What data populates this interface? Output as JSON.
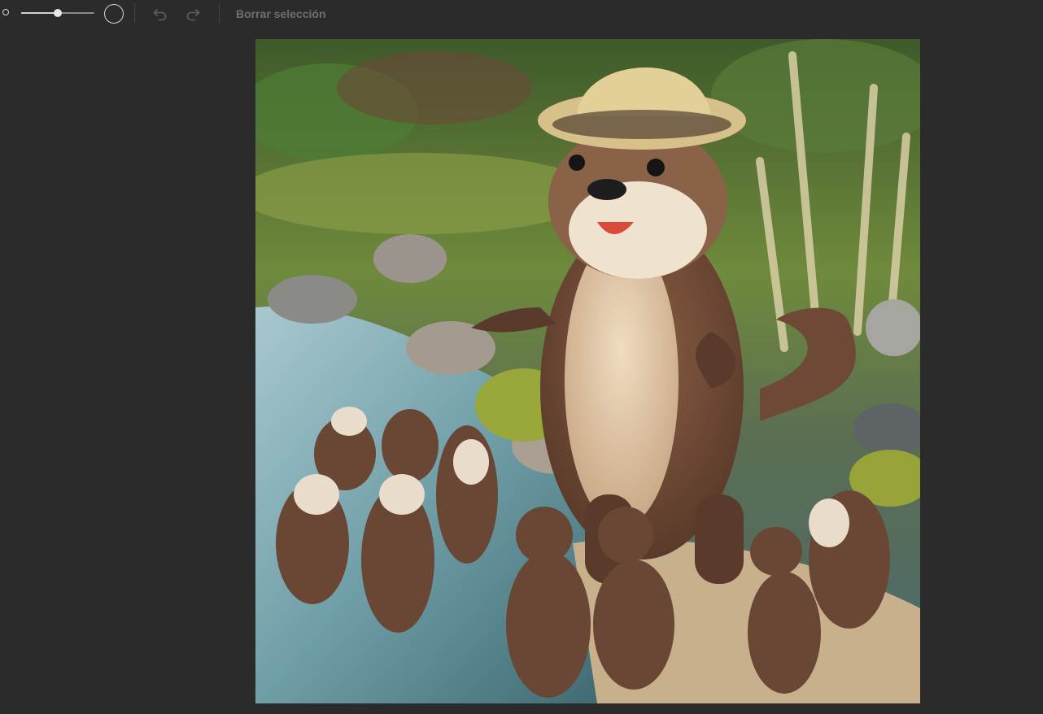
{
  "toolbar": {
    "brush_size_small_icon": "circle-small-icon",
    "brush_size_large_icon": "circle-large-icon",
    "brush_size_level": 0.5,
    "undo_icon": "undo-icon",
    "redo_icon": "redo-icon",
    "clear_selection_label": "Borrar selección"
  },
  "canvas": {
    "image_subject": "otter-illustration",
    "colors": {
      "background": "#2b2b2b",
      "toolbar_icon": "#d6d6d6",
      "disabled_text": "#6f6f6f"
    }
  }
}
